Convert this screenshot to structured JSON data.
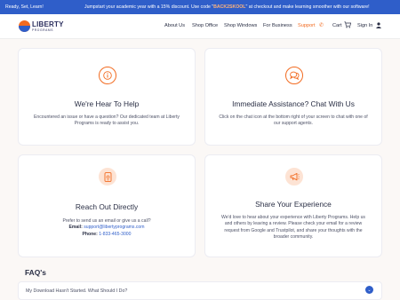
{
  "promo": {
    "left_text": "Ready, Set, Learn!",
    "text_before": "Jumpstart your academic year with a 15% discount. Use code \"",
    "code": "BACK2SKOOL",
    "text_after": "\" at checkout and make learning smoother with our software!"
  },
  "brand": {
    "line1": "LIBERTY",
    "line2": "PROGRAMS"
  },
  "nav": {
    "about": "About Us",
    "office": "Shop Office",
    "windows": "Shop Windows",
    "business": "For Business",
    "support": "Support",
    "cart": "Cart",
    "signin": "Sign In"
  },
  "cards": {
    "help": {
      "title": "We're Hear To Help",
      "body": "Encountered an issue or have a question? Our dedicated team at Liberty Programs is ready to assist you."
    },
    "chat": {
      "title": "Immediate Assistance? Chat With Us",
      "body": "Click on the chat icon at the bottom right of your screen to chat with one of our support agents."
    },
    "reach": {
      "title": "Reach Out Directly",
      "body": "Prefer to send us an email or give us a call?",
      "email_label": "Email:",
      "email": "support@libertyprograms.com",
      "phone_label": "Phone:",
      "phone": "1-833-465-3000"
    },
    "share": {
      "title": "Share Your Experience",
      "body": "We'd love to hear about your experience with Liberty Programs. Help us and others by leaving a review. Please check your email for a review request from Google and Trustpilot, and share your thoughts with the broader community."
    }
  },
  "faq": {
    "heading": "FAQ's",
    "q1": "My Download Hasn't Started. What Should I Do?"
  },
  "icons": {
    "info": "info-icon",
    "chat": "chat-bubbles-icon",
    "phone": "phone-icon",
    "megaphone": "megaphone-icon",
    "cart": "cart-icon",
    "user": "user-icon",
    "toggle": "chevron-down-icon"
  },
  "colors": {
    "accent": "#f26b21",
    "brand_blue": "#2f5ec9",
    "background": "#fbf8f6"
  }
}
